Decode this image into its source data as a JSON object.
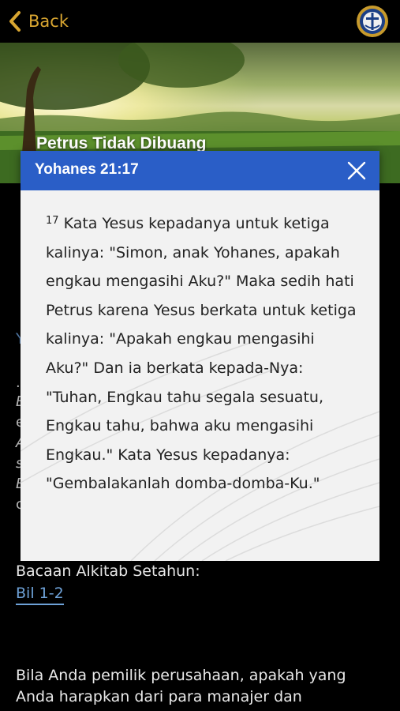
{
  "nav": {
    "back_label": "Back",
    "logo_icon": "church-logo-icon"
  },
  "banner": {
    "title": "Petrus Tidak Dibuang"
  },
  "article": {
    "link_fragment": "Y",
    "fragment_lines": [
      "..",
      "B",
      "e",
      "A",
      "s",
      "E",
      "c"
    ],
    "reading_label": "Bacaan Alkitab Setahun:",
    "reading_link": "Bil 1-2",
    "body_lines": [
      "Bila Anda pemilik perusahaan, apakah yang",
      "Anda harapkan dari para manajer dan"
    ]
  },
  "modal": {
    "title": "Yohanes 21:17",
    "verse_number": "17",
    "verse_text": "Kata Yesus kepadanya untuk ketiga kalinya: \"Simon, anak Yohanes, apakah engkau mengasihi Aku?\" Maka sedih hati Petrus karena Yesus berkata untuk ketiga kalinya: \"Apakah engkau mengasihi Aku?\" Dan ia berkata kepada-Nya: \"Tuhan, Engkau tahu segala sesuatu, Engkau tahu, bahwa aku mengasihi Engkau.\" Kata Yesus kepadanya: \"Gembalakanlah domba-domba-Ku.\""
  },
  "colors": {
    "accent_gold": "#d9a631",
    "modal_header_blue": "#2a5ec7",
    "link_blue": "#6ea2d8"
  }
}
